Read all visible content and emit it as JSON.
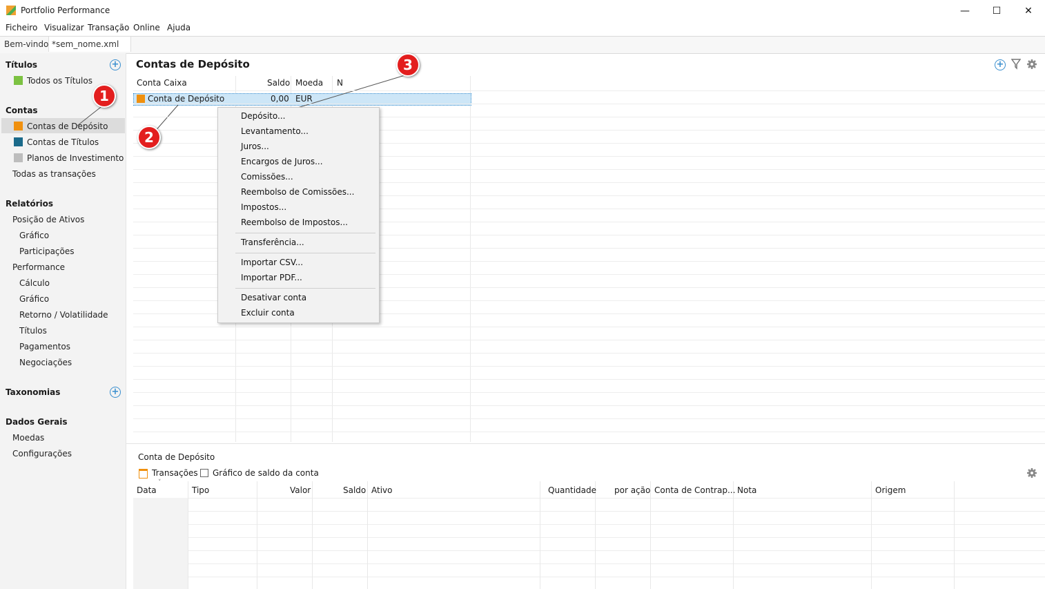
{
  "window": {
    "title": "Portfolio Performance",
    "minimize": "—",
    "maximize": "☐",
    "close": "✕"
  },
  "menu": [
    "Ficheiro",
    "Visualizar",
    "Transação",
    "Online",
    "Ajuda"
  ],
  "tabs": [
    {
      "label": "Bem-vindo"
    },
    {
      "label": "*sem_nome.xml",
      "close": "✕"
    }
  ],
  "sidebar": {
    "titulos": {
      "heading": "Títulos",
      "items": [
        "Todos os Títulos"
      ]
    },
    "contas": {
      "heading": "Contas",
      "items": [
        "Contas de Depósito",
        "Contas de Títulos",
        "Planos de Investimento",
        "Todas as transações"
      ]
    },
    "relatorios": {
      "heading": "Relatórios",
      "items": [
        "Posição de Ativos",
        "Gráfico",
        "Participações",
        "Performance",
        "Cálculo",
        "Gráfico",
        "Retorno / Volatilidade",
        "Títulos",
        "Pagamentos",
        "Negociações"
      ]
    },
    "taxonomias": {
      "heading": "Taxonomias"
    },
    "dados": {
      "heading": "Dados Gerais",
      "items": [
        "Moedas",
        "Configurações"
      ]
    }
  },
  "main": {
    "title": "Contas de Depósito",
    "columns": [
      "Conta Caixa",
      "Saldo",
      "Moeda",
      "N"
    ],
    "rows": [
      {
        "name": "Conta de Depósito",
        "saldo": "0,00",
        "moeda": "EUR"
      }
    ]
  },
  "context_menu": {
    "group1": [
      "Depósito...",
      "Levantamento...",
      "Juros...",
      "Encargos de Juros...",
      "Comissões...",
      "Reembolso de Comissões...",
      "Impostos...",
      "Reembolso de Impostos..."
    ],
    "group2": [
      "Transferência..."
    ],
    "group3": [
      "Importar CSV...",
      "Importar PDF..."
    ],
    "group4": [
      "Desativar conta",
      "Excluir conta"
    ]
  },
  "badges": [
    "1",
    "2",
    "3"
  ],
  "bottom": {
    "title": "Conta de Depósito",
    "tabs": [
      "Transações",
      "Gráfico de saldo da conta"
    ],
    "columns": [
      "Data",
      "Tipo",
      "Valor",
      "Saldo",
      "Ativo",
      "Quantidade",
      "por ação",
      "Conta de Contrap...",
      "Nota",
      "Origem"
    ]
  },
  "colors": {
    "accent": "#3a8fcf",
    "deposit_account": "#f0900e",
    "securities_account": "#1b6a8a",
    "plans": "#bdbdbd",
    "badge": "#e31e1e"
  },
  "icons": [
    "app-icon",
    "add-icon",
    "filter-icon",
    "gear-icon",
    "close-icon",
    "sort-chevron-icon"
  ]
}
